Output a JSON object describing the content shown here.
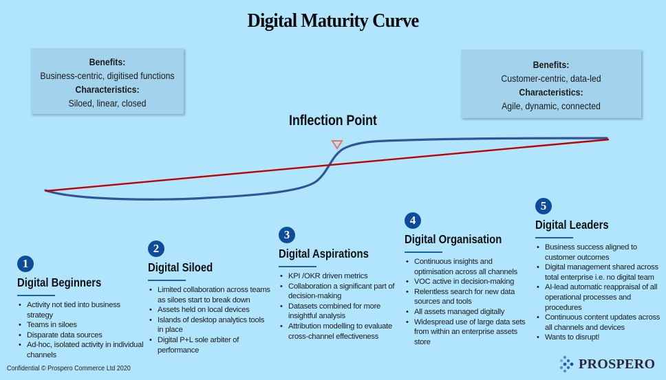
{
  "title": "Digital Maturity Curve",
  "left_box": {
    "benefits_label": "Benefits:",
    "benefits": "Business-centric, digitised functions",
    "characteristics_label": "Characteristics:",
    "characteristics": "Siloed, linear, closed"
  },
  "right_box": {
    "benefits_label": "Benefits:",
    "benefits": "Customer-centric, data-led",
    "characteristics_label": "Characteristics:",
    "characteristics": "Agile, dynamic, connected"
  },
  "inflection_label": "Inflection Point",
  "colors": {
    "background": "#b1e4fd",
    "box": "#a3d3ec",
    "s_curve": "#2f5597",
    "linear_line": "#c00000",
    "marker": "#f0705a",
    "badge": "#0d4c9b",
    "rule": "#1f5ea8"
  },
  "stages": [
    {
      "number": "1",
      "title": "Digital Beginners",
      "bullets": [
        "Activity not tied into business strategy",
        "Teams in siloes",
        "Disparate data sources",
        "Ad-hoc, isolated activity in individual channels"
      ]
    },
    {
      "number": "2",
      "title": "Digital Siloed",
      "bullets": [
        "Limited collaboration across teams as siloes start to break down",
        "Assets held on local devices",
        "Islands of desktop analytics tools in place",
        "Digital P+L sole arbiter of performance"
      ]
    },
    {
      "number": "3",
      "title": "Digital Aspirations",
      "bullets": [
        "KPI /OKR driven metrics",
        "Collaboration a significant part of decision-making",
        "Datasets combined for more insightful analysis",
        "Attribution modelling to evaluate cross-channel effectiveness"
      ]
    },
    {
      "number": "4",
      "title": "Digital Organisation",
      "bullets": [
        "Continuous insights and optimisation across all channels",
        "VOC active in decision-making",
        "Relentless search for new data sources and tools",
        "All assets managed digitally",
        "Widespread use of large data sets from within an enterprise assets store"
      ]
    },
    {
      "number": "5",
      "title": "Digital Leaders",
      "bullets": [
        "Business success aligned to customer outcomes",
        "Digital management shared across total enterprise i.e. no digital team",
        "AI-lead automatic reappraisal of all operational processes and procedures",
        "Continuous content updates across all channels and devices",
        "Wants to disrupt!"
      ]
    }
  ],
  "footer": "Confidential  © Prospero Commerce Ltd 2020",
  "logo_text": "PROSPERO"
}
